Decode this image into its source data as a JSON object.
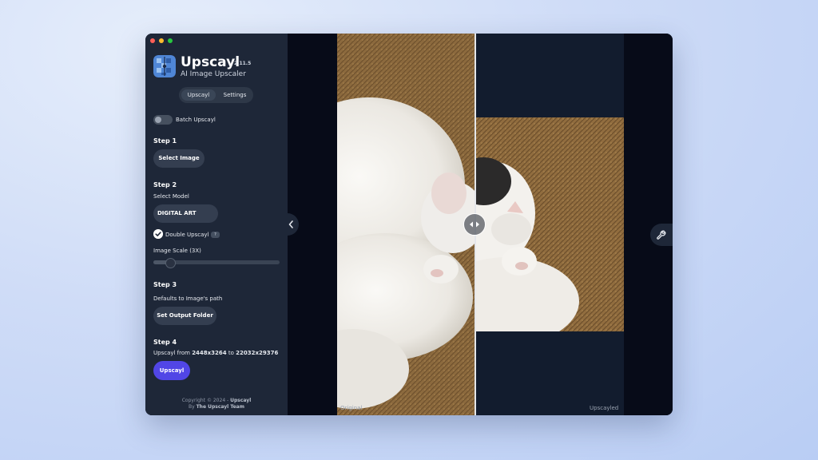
{
  "window": {
    "traffic_lights": [
      "#ff5f57",
      "#febc2e",
      "#28c840"
    ]
  },
  "sidebar": {
    "app_name": "Upscayl",
    "version": "2.11.5",
    "tagline": "AI Image Upscaler",
    "tabs": [
      {
        "label": "Upscayl",
        "active": true
      },
      {
        "label": "Settings",
        "active": false
      }
    ],
    "batch_toggle": {
      "label": "Batch Upscayl",
      "on": false
    },
    "step1": {
      "title": "Step 1",
      "button": "Select Image"
    },
    "step2": {
      "title": "Step 2",
      "select_label": "Select Model",
      "model_value": "DIGITAL ART",
      "double_upscayl": {
        "label": "Double Upscayl",
        "checked": true,
        "badge": "?"
      },
      "scale_label": "Image Scale (3X)",
      "scale_fraction": 0.1
    },
    "step3": {
      "title": "Step 3",
      "hint": "Defaults to Image's path",
      "button": "Set Output Folder"
    },
    "step4": {
      "title": "Step 4",
      "from_prefix": "Upscayl from ",
      "from_size": "2448x3264",
      "to_word": " to ",
      "to_size": "22032x29376",
      "button": "Upscayl"
    },
    "footer": {
      "copyright_prefix": "Copyright © 2024 - ",
      "copyright_name": "Upscayl",
      "by_prefix": "By ",
      "team": "The Upscayl Team"
    }
  },
  "viewer": {
    "label_original": "Original",
    "label_upscayled": "Upscayled",
    "icons": [
      "chevron-left-icon",
      "compare-arrows-icon",
      "wrench-icon"
    ],
    "colors": {
      "accent": "#5146e6",
      "panel": "#1e2738",
      "canvas": "#070b18"
    }
  }
}
